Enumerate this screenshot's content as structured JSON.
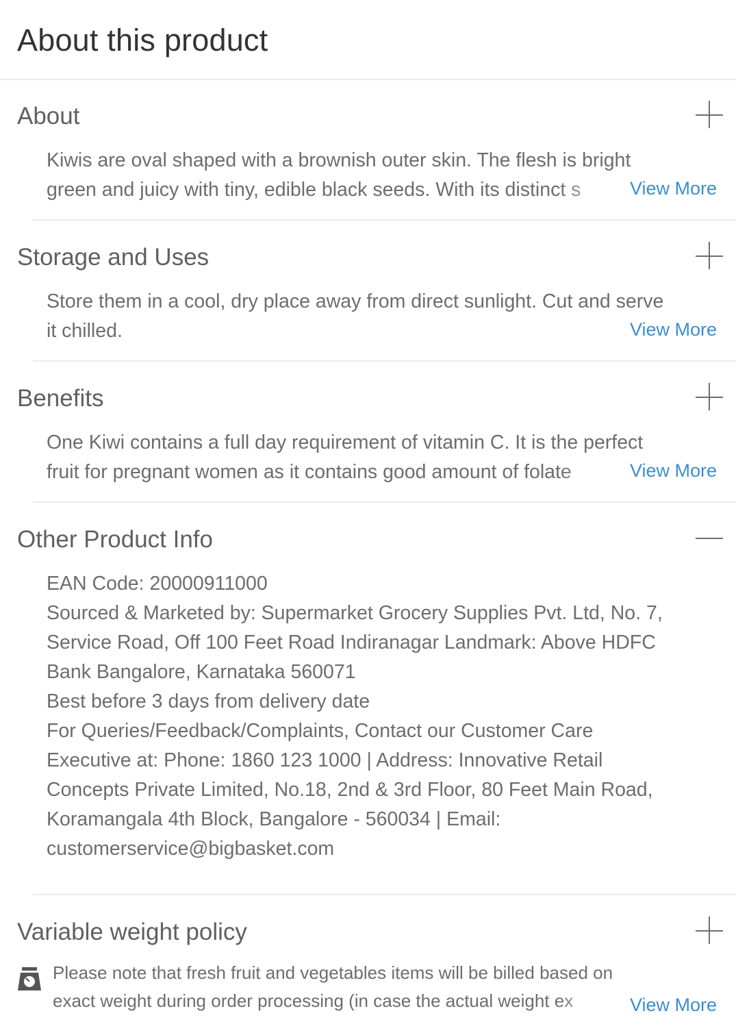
{
  "header": {
    "title": "About this product"
  },
  "sections": {
    "about": {
      "title": "About",
      "line1": "Kiwis are oval shaped with a brownish outer skin. The flesh is bright",
      "line2": "green and juicy with tiny, edible black seeds. With its distinct s",
      "view_more": "View More",
      "toggle_icon": "plus-icon"
    },
    "storage": {
      "title": "Storage and Uses",
      "line1": "Store them in a cool, dry place away from direct sunlight. Cut and serve",
      "line2": "it chilled.",
      "view_more": "View More",
      "toggle_icon": "plus-icon"
    },
    "benefits": {
      "title": "Benefits",
      "line1": "One Kiwi contains a full day requirement of vitamin C. It is the perfect",
      "line2": "fruit for pregnant women as it contains good amount of folate",
      "view_more": "View More",
      "toggle_icon": "plus-icon"
    },
    "other_info": {
      "title": "Other Product Info",
      "toggle_icon": "minus-icon",
      "lines": [
        "EAN Code: 20000911000",
        "Sourced & Marketed by: Supermarket Grocery Supplies Pvt. Ltd, No. 7,",
        "Service Road, Off 100 Feet Road Indiranagar Landmark: Above HDFC",
        "Bank Bangalore, Karnataka 560071",
        "Best before 3 days from delivery date",
        "For Queries/Feedback/Complaints, Contact our Customer Care",
        "Executive at: Phone: 1860 123 1000 | Address: Innovative Retail",
        "Concepts Private Limited, No.18, 2nd & 3rd Floor, 80 Feet Main Road,",
        "Koramangala 4th Block, Bangalore - 560034 | Email:",
        "customerservice@bigbasket.com"
      ]
    },
    "weight_policy": {
      "title": "Variable weight policy",
      "icon": "weighing-scale-icon",
      "line1": "Please note that fresh fruit and vegetables items will be billed based on",
      "line2": "exact weight during order processing (in case the actual weight ex",
      "view_more": "View More",
      "toggle_icon": "plus-icon"
    }
  }
}
